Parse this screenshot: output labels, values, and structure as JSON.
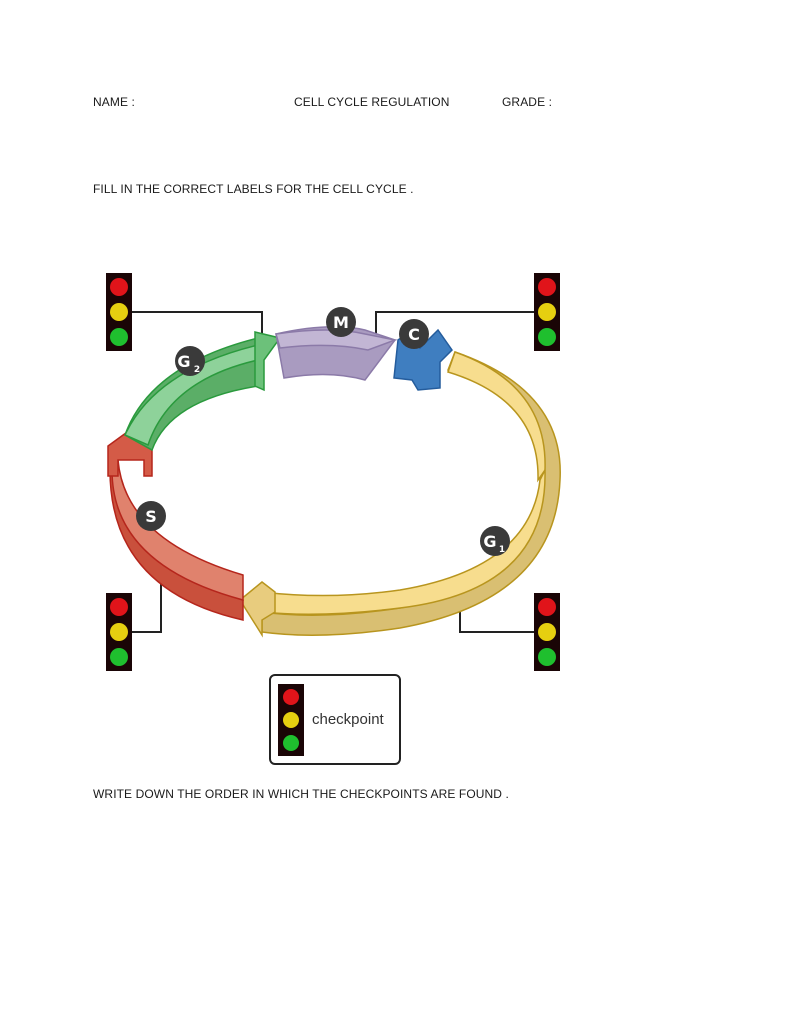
{
  "header": {
    "name_label": "NAME :",
    "title": "CELL CYCLE REGULATION",
    "grade_label": "GRADE :"
  },
  "instructions": {
    "fill_labels": "FILL IN THE CORRECT LABELS FOR THE CELL CYCLE .",
    "write_order": "WRITE DOWN THE ORDER IN WHICH THE CHECKPOINTS ARE FOUND ."
  },
  "diagram": {
    "phases": [
      {
        "id": "G1",
        "letter": "G",
        "sub": "1",
        "color": "#f7dd8e"
      },
      {
        "id": "S",
        "letter": "S",
        "sub": "",
        "color": "#d9634f"
      },
      {
        "id": "G2",
        "letter": "G",
        "sub": "2",
        "color": "#6cc17a"
      },
      {
        "id": "M",
        "letter": "M",
        "sub": "",
        "color": "#a99bc0"
      },
      {
        "id": "C",
        "letter": "C",
        "sub": "",
        "color": "#3f7ec0"
      }
    ],
    "legend": {
      "label": "checkpoint"
    },
    "traffic_light_colors": {
      "red": "#e0141a",
      "yellow": "#e6cf10",
      "green": "#1fbf2e",
      "housing": "#1a0506"
    }
  }
}
